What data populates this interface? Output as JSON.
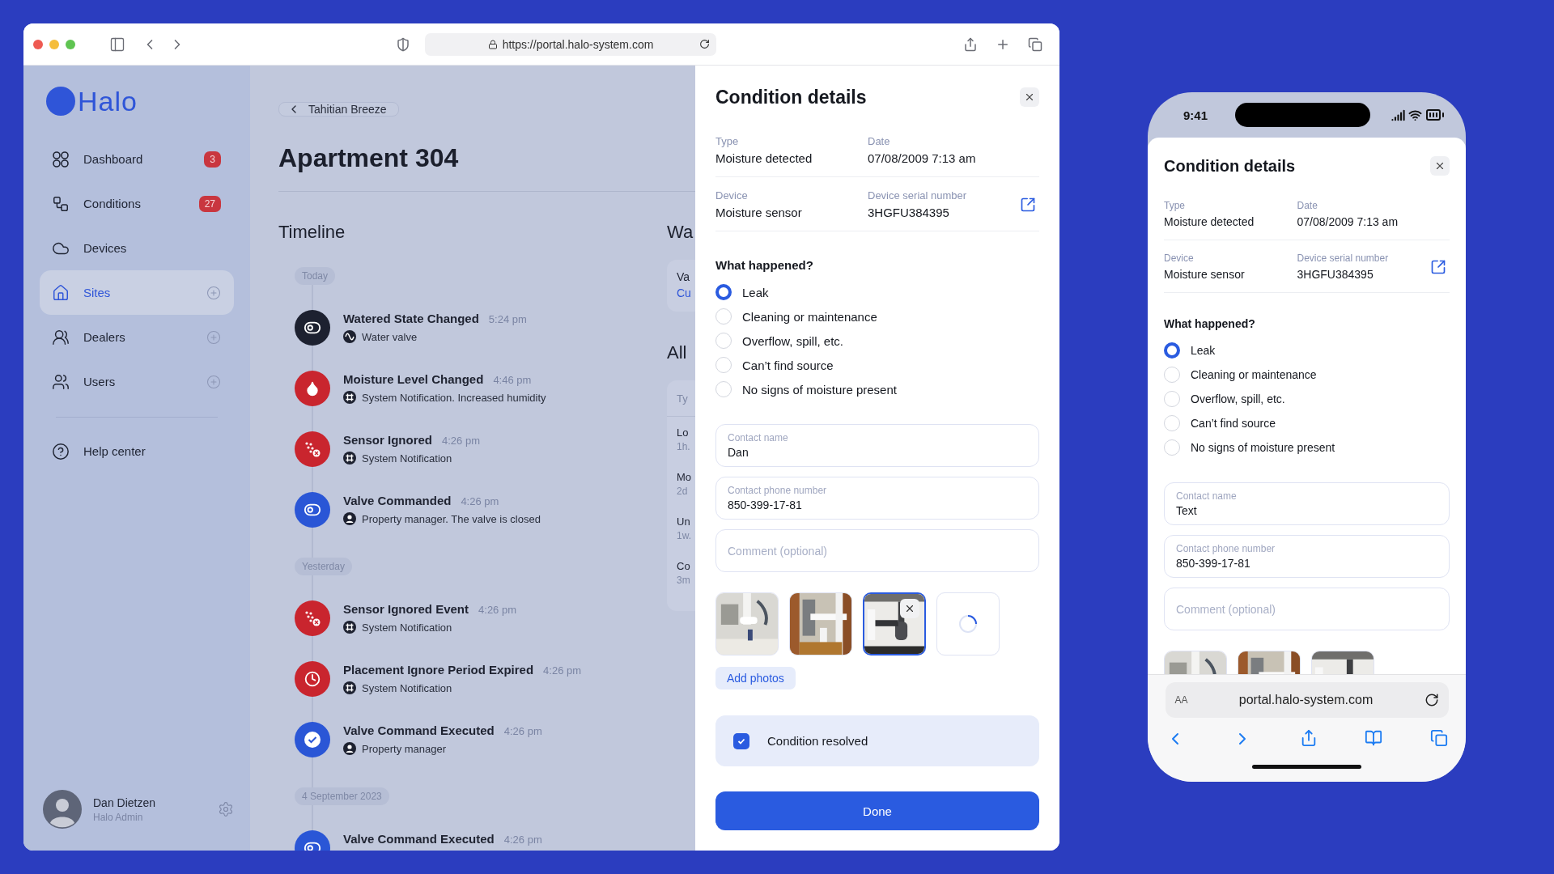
{
  "browser": {
    "url": "https://portal.halo-system.com"
  },
  "sidebar": {
    "logo": "Halo",
    "nav": [
      {
        "label": "Dashboard",
        "badge": "3",
        "selected": false,
        "addable": false
      },
      {
        "label": "Conditions",
        "badge": "27",
        "selected": false,
        "addable": false
      },
      {
        "label": "Devices",
        "selected": false,
        "addable": false
      },
      {
        "label": "Sites",
        "selected": true,
        "addable": true
      },
      {
        "label": "Dealers",
        "selected": false,
        "addable": true
      },
      {
        "label": "Users",
        "selected": false,
        "addable": true
      }
    ],
    "help": "Help center",
    "user": {
      "name": "Dan Dietzen",
      "role": "Halo Admin"
    }
  },
  "page": {
    "back": "Tahitian Breeze",
    "title": "Apartment 304"
  },
  "timeline": {
    "title": "Timeline",
    "groups": [
      {
        "label": "Today",
        "events": [
          {
            "title": "Watered State Changed",
            "time": "5:24 pm",
            "kind": "toggle",
            "color": "#1d2130",
            "source": {
              "kind": "wave",
              "text": "Water valve"
            }
          },
          {
            "title": "Moisture Level Changed",
            "time": "4:46 pm",
            "kind": "drop",
            "color": "#c9252e",
            "source": {
              "kind": "chip",
              "text": "System Notification. Increased humidity"
            }
          },
          {
            "title": "Sensor Ignored",
            "time": "4:26 pm",
            "kind": "scatter",
            "color": "#c9252e",
            "source": {
              "kind": "chip",
              "text": "System Notification"
            }
          },
          {
            "title": "Valve Commanded",
            "time": "4:26 pm",
            "kind": "toggle",
            "color": "#2a56d6",
            "source": {
              "kind": "person",
              "text": "Property manager. The valve is closed"
            }
          }
        ]
      },
      {
        "label": "Yesterday",
        "events": [
          {
            "title": "Sensor Ignored Event",
            "time": "4:26 pm",
            "kind": "scatter",
            "color": "#c9252e",
            "source": {
              "kind": "chip",
              "text": "System Notification"
            }
          },
          {
            "title": "Placement Ignore Period Expired",
            "time": "4:26 pm",
            "kind": "clock",
            "color": "#c9252e",
            "source": {
              "kind": "chip",
              "text": "System Notification"
            }
          },
          {
            "title": "Valve Command Executed",
            "time": "4:26 pm",
            "kind": "check",
            "color": "#2a56d6",
            "source": {
              "kind": "person",
              "text": "Property manager"
            }
          }
        ]
      },
      {
        "label": "4 September 2023",
        "events": [
          {
            "title": "Valve Command Executed",
            "time": "4:26 pm",
            "kind": "toggle",
            "color": "#2a56d6"
          }
        ]
      }
    ]
  },
  "side_column": {
    "title": "Wa",
    "card_lines": [
      "Va",
      "Cu"
    ],
    "title_2": "All",
    "table_header": "Ty",
    "rows": [
      {
        "line_1": "Lo",
        "line_2": "1h."
      },
      {
        "line_1": "Mo",
        "line_2": "2d"
      },
      {
        "line_1": "Un",
        "line_2": "1w."
      },
      {
        "line_1": "Co",
        "line_2": "3m"
      }
    ]
  },
  "panel": {
    "title": "Condition details",
    "fields": [
      {
        "label": "Type",
        "value": "Moisture detected"
      },
      {
        "label": "Date",
        "value": "07/08/2009 7:13 am"
      },
      {
        "label": "Device",
        "value": "Moisture sensor"
      },
      {
        "label": "Device serial number",
        "value": "3HGFU384395"
      }
    ],
    "question": "What happened?",
    "options": [
      {
        "label": "Leak",
        "selected": true
      },
      {
        "label": "Cleaning or maintenance",
        "selected": false
      },
      {
        "label": "Overflow, spill, etc.",
        "selected": false
      },
      {
        "label": "Can’t find source",
        "selected": false
      },
      {
        "label": "No signs of moisture present",
        "selected": false
      }
    ],
    "inputs": [
      {
        "label": "Contact name",
        "value": "Dan"
      },
      {
        "label": "Contact phone number",
        "value": "850-399-17-81"
      },
      {
        "placeholder": "Comment (optional)"
      }
    ],
    "photos": [
      {
        "kind": "picture",
        "selected": false
      },
      {
        "kind": "picture",
        "selected": false
      },
      {
        "kind": "picture",
        "selected": true
      },
      {
        "kind": "loading",
        "selected": false
      }
    ],
    "add_photos": "Add photos",
    "resolved": {
      "label": "Condition resolved",
      "checked": true
    },
    "done": "Done"
  },
  "phone": {
    "time": "9:41",
    "panel": {
      "title": "Condition details",
      "fields": [
        {
          "label": "Type",
          "value": "Moisture detected"
        },
        {
          "label": "Date",
          "value": "07/08/2009 7:13 am"
        },
        {
          "label": "Device",
          "value": "Moisture sensor"
        },
        {
          "label": "Device serial number",
          "value": "3HGFU384395"
        }
      ],
      "question": "What happened?",
      "options": [
        {
          "label": "Leak",
          "selected": true
        },
        {
          "label": "Cleaning or maintenance",
          "selected": false
        },
        {
          "label": "Overflow, spill, etc.",
          "selected": false
        },
        {
          "label": "Can’t find source",
          "selected": false
        },
        {
          "label": "No signs of moisture present",
          "selected": false
        }
      ],
      "inputs": [
        {
          "label": "Contact name",
          "value": "Text"
        },
        {
          "label": "Contact phone number",
          "value": "850-399-17-81"
        },
        {
          "placeholder": "Comment (optional)"
        }
      ],
      "photos": [
        {
          "kind": "picture",
          "selected": false
        },
        {
          "kind": "picture",
          "selected": false
        },
        {
          "kind": "picture",
          "selected": false
        }
      ]
    },
    "text_size": "AA",
    "url": "portal.halo-system.com"
  }
}
